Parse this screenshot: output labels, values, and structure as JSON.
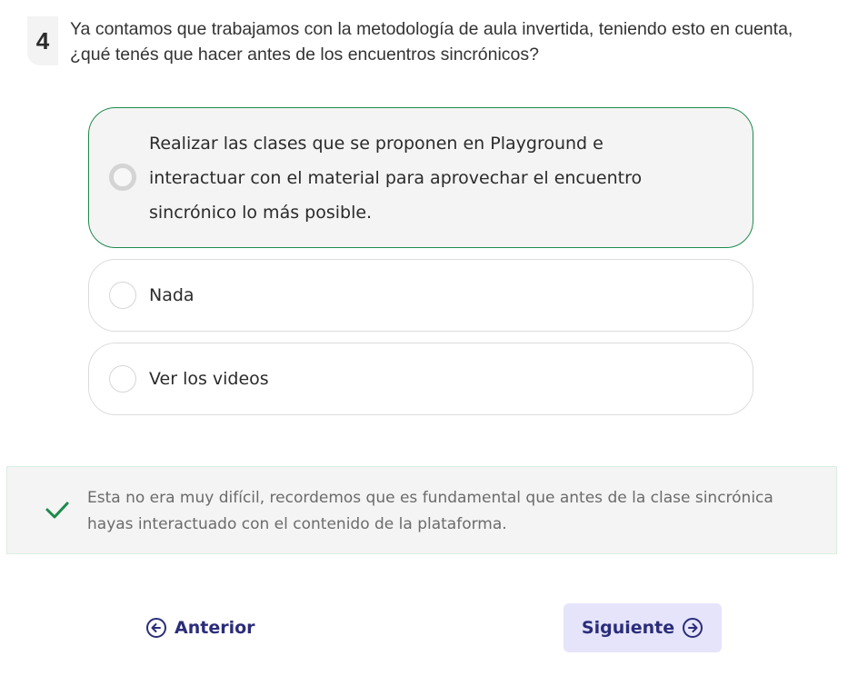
{
  "question": {
    "number": "4",
    "text": "Ya contamos que trabajamos con la metodología de aula invertida, teniendo esto en cuenta, ¿qué tenés que hacer antes de los encuentros sincrónicos?"
  },
  "options": [
    {
      "label": "Realizar las clases que se proponen en Playground e interactuar con el material para aprovechar el encuentro sincrónico lo más posible.",
      "selected": true
    },
    {
      "label": "Nada",
      "selected": false
    },
    {
      "label": "Ver los videos",
      "selected": false
    }
  ],
  "feedback": {
    "icon": "check-icon",
    "text": "Esta no era muy difícil, recordemos que es fundamental que antes de la clase sincrónica hayas interactuado con el contenido de la plataforma."
  },
  "navigation": {
    "prev_label": "Anterior",
    "prev_icon": "arrow-left-circle-icon",
    "next_label": "Siguiente",
    "next_icon": "arrow-right-circle-icon"
  },
  "colors": {
    "selected_border": "#1e8a4f",
    "check": "#1a8a4a",
    "nav_text": "#2b2d7a",
    "next_bg": "#e5e4fb"
  }
}
